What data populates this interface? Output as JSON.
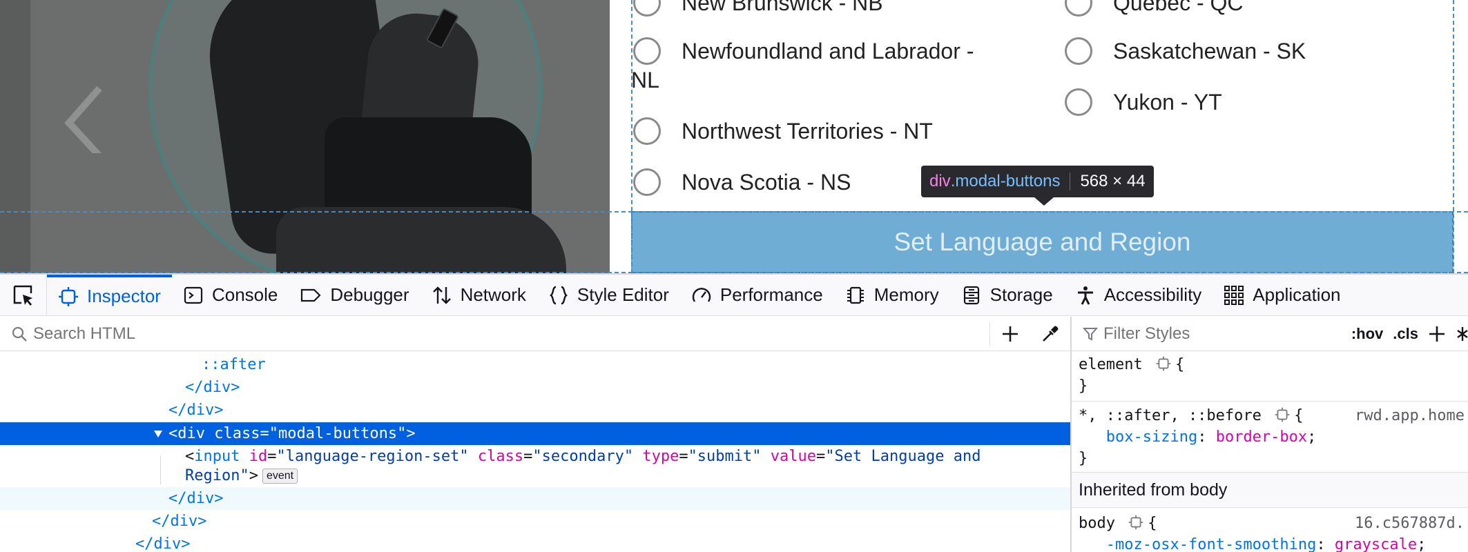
{
  "page": {
    "regions_left": [
      {
        "label": "New Brunswick - NB"
      },
      {
        "label": "Newfoundland and Labrador -",
        "label2": "NL"
      },
      {
        "label": "Northwest Territories - NT"
      },
      {
        "label": "Nova Scotia - NS"
      }
    ],
    "regions_right": [
      {
        "label": "Quebec - QC"
      },
      {
        "label": "Saskatchewan - SK"
      },
      {
        "label": "Yukon - YT"
      }
    ],
    "set_button_label": "Set Language and Region"
  },
  "tooltip": {
    "tag": "div",
    "cls": ".modal-buttons",
    "size": "568 × 44"
  },
  "devtools": {
    "tabs": [
      {
        "label": "Inspector",
        "icon": "inspector-icon"
      },
      {
        "label": "Console",
        "icon": "console-icon"
      },
      {
        "label": "Debugger",
        "icon": "debugger-icon"
      },
      {
        "label": "Network",
        "icon": "network-icon"
      },
      {
        "label": "Style Editor",
        "icon": "style-editor-icon"
      },
      {
        "label": "Performance",
        "icon": "performance-icon"
      },
      {
        "label": "Memory",
        "icon": "memory-icon"
      },
      {
        "label": "Storage",
        "icon": "storage-icon"
      },
      {
        "label": "Accessibility",
        "icon": "accessibility-icon"
      },
      {
        "label": "Application",
        "icon": "application-icon"
      }
    ],
    "search_placeholder": "Search HTML",
    "filter_placeholder": "Filter Styles",
    "hov_label": ":hov",
    "cls_label": ".cls",
    "markup": {
      "after": "::after",
      "close_div": "</div>",
      "sel_open": "<",
      "sel_tag": "div",
      "sel_attr": "class",
      "sel_val": "\"modal-buttons\"",
      "input_tag": "input",
      "input_id_attr": "id",
      "input_id_val": "\"language-region-set\"",
      "input_class_attr": "class",
      "input_class_val": "\"secondary\"",
      "input_type_attr": "type",
      "input_type_val": "\"submit\"",
      "input_value_attr": "value",
      "input_value_val": "\"Set Language and",
      "input_value_cont": "Region\"",
      "event_badge": "event"
    },
    "rules": {
      "element_selector": "element",
      "universal_selector": "*, ::after, ::before",
      "box_sizing_prop": "box-sizing",
      "box_sizing_val": "border-box",
      "universal_source": "rwd.app.home",
      "inherited_label": "Inherited from body",
      "body_selector": "body",
      "body_source": "16.c567887d.",
      "font_smoothing_prop": "-moz-osx-font-smoothing",
      "font_smoothing_val": "grayscale"
    }
  }
}
